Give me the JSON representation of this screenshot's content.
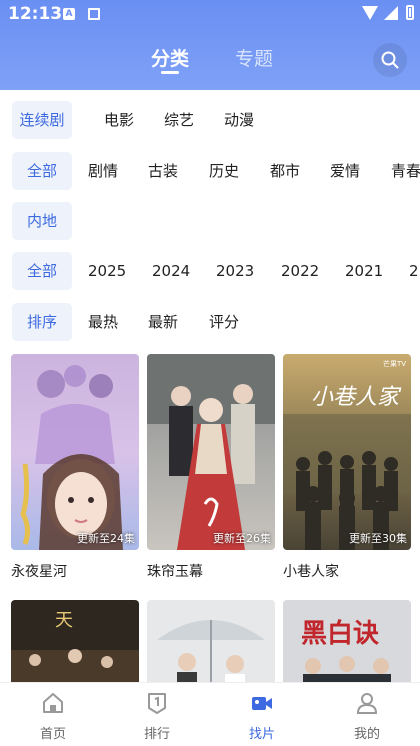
{
  "status_bar": {
    "time": "12:13",
    "notification_badge": "A"
  },
  "header": {
    "tabs": [
      {
        "label": "分类",
        "active": true
      },
      {
        "label": "专题",
        "active": false
      }
    ],
    "search_icon": "search-icon"
  },
  "filters": {
    "type": [
      "连续剧",
      "电影",
      "综艺",
      "动漫"
    ],
    "genre": [
      "全部",
      "剧情",
      "古装",
      "历史",
      "都市",
      "爱情",
      "青春"
    ],
    "region": [
      "内地"
    ],
    "year": [
      "全部",
      "2025",
      "2024",
      "2023",
      "2022",
      "2021",
      "2"
    ],
    "sort": [
      "排序",
      "最热",
      "最新",
      "评分"
    ],
    "selected": {
      "type": "连续剧",
      "genre": "全部",
      "region": "内地",
      "year": "全部",
      "sort": "排序"
    }
  },
  "shows": [
    {
      "title": "永夜星河",
      "update": "更新至24集"
    },
    {
      "title": "珠帘玉幕",
      "update": "更新至26集"
    },
    {
      "title": "小巷人家",
      "update": "更新至30集"
    },
    {
      "title": "",
      "update": ""
    },
    {
      "title": "",
      "update": ""
    },
    {
      "title": "",
      "update": ""
    }
  ],
  "poster_text": {
    "show_3_calligraphy": "小巷人家",
    "show_6_title": "黑白诀",
    "show_3_logo": "芒果TV"
  },
  "bottom_nav": [
    {
      "label": "首页",
      "icon": "home-icon",
      "active": false
    },
    {
      "label": "排行",
      "icon": "ranking-icon",
      "active": false
    },
    {
      "label": "找片",
      "icon": "video-camera-icon",
      "active": true
    },
    {
      "label": "我的",
      "icon": "user-icon",
      "active": false
    }
  ],
  "colors": {
    "accent": "#3d6ae0",
    "header_top": "#6a8ff3",
    "header_bottom": "#7fa1f6",
    "chip_bg": "#eef2fb"
  }
}
